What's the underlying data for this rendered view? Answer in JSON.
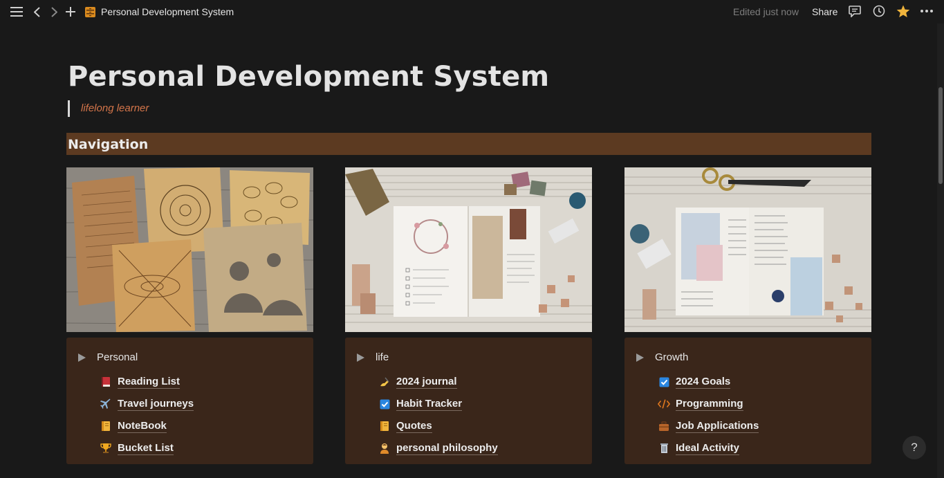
{
  "topbar": {
    "title": "Personal Development System",
    "edited": "Edited just now",
    "share": "Share"
  },
  "page": {
    "title": "Personal Development System",
    "quote": "lifelong learner",
    "nav_header": "Navigation"
  },
  "cards": [
    {
      "toggle": "Personal",
      "links": [
        {
          "icon": "red-book-icon",
          "label": "Reading List"
        },
        {
          "icon": "airplane-icon",
          "label": "Travel journeys"
        },
        {
          "icon": "notebook-icon",
          "label": "NoteBook"
        },
        {
          "icon": "trophy-icon",
          "label": "Bucket List"
        }
      ]
    },
    {
      "toggle": "life",
      "links": [
        {
          "icon": "writing-hand-icon",
          "label": "2024 journal"
        },
        {
          "icon": "checkbox-icon",
          "label": "Habit Tracker"
        },
        {
          "icon": "notebook-icon",
          "label": "Quotes"
        },
        {
          "icon": "person-icon",
          "label": "personal philosophy"
        }
      ]
    },
    {
      "toggle": "Growth",
      "links": [
        {
          "icon": "checkbox-icon",
          "label": "2024 Goals"
        },
        {
          "icon": "code-icon",
          "label": "Programming"
        },
        {
          "icon": "briefcase-icon",
          "label": "Job Applications"
        },
        {
          "icon": "trash-can-icon",
          "label": "Ideal Activity"
        }
      ]
    }
  ],
  "help": "?",
  "colors": {
    "background": "#191919",
    "nav_header": "#5c3a21",
    "card_panel": "#3a261a",
    "quote_text": "#d4754a",
    "star": "#f0b43c"
  }
}
